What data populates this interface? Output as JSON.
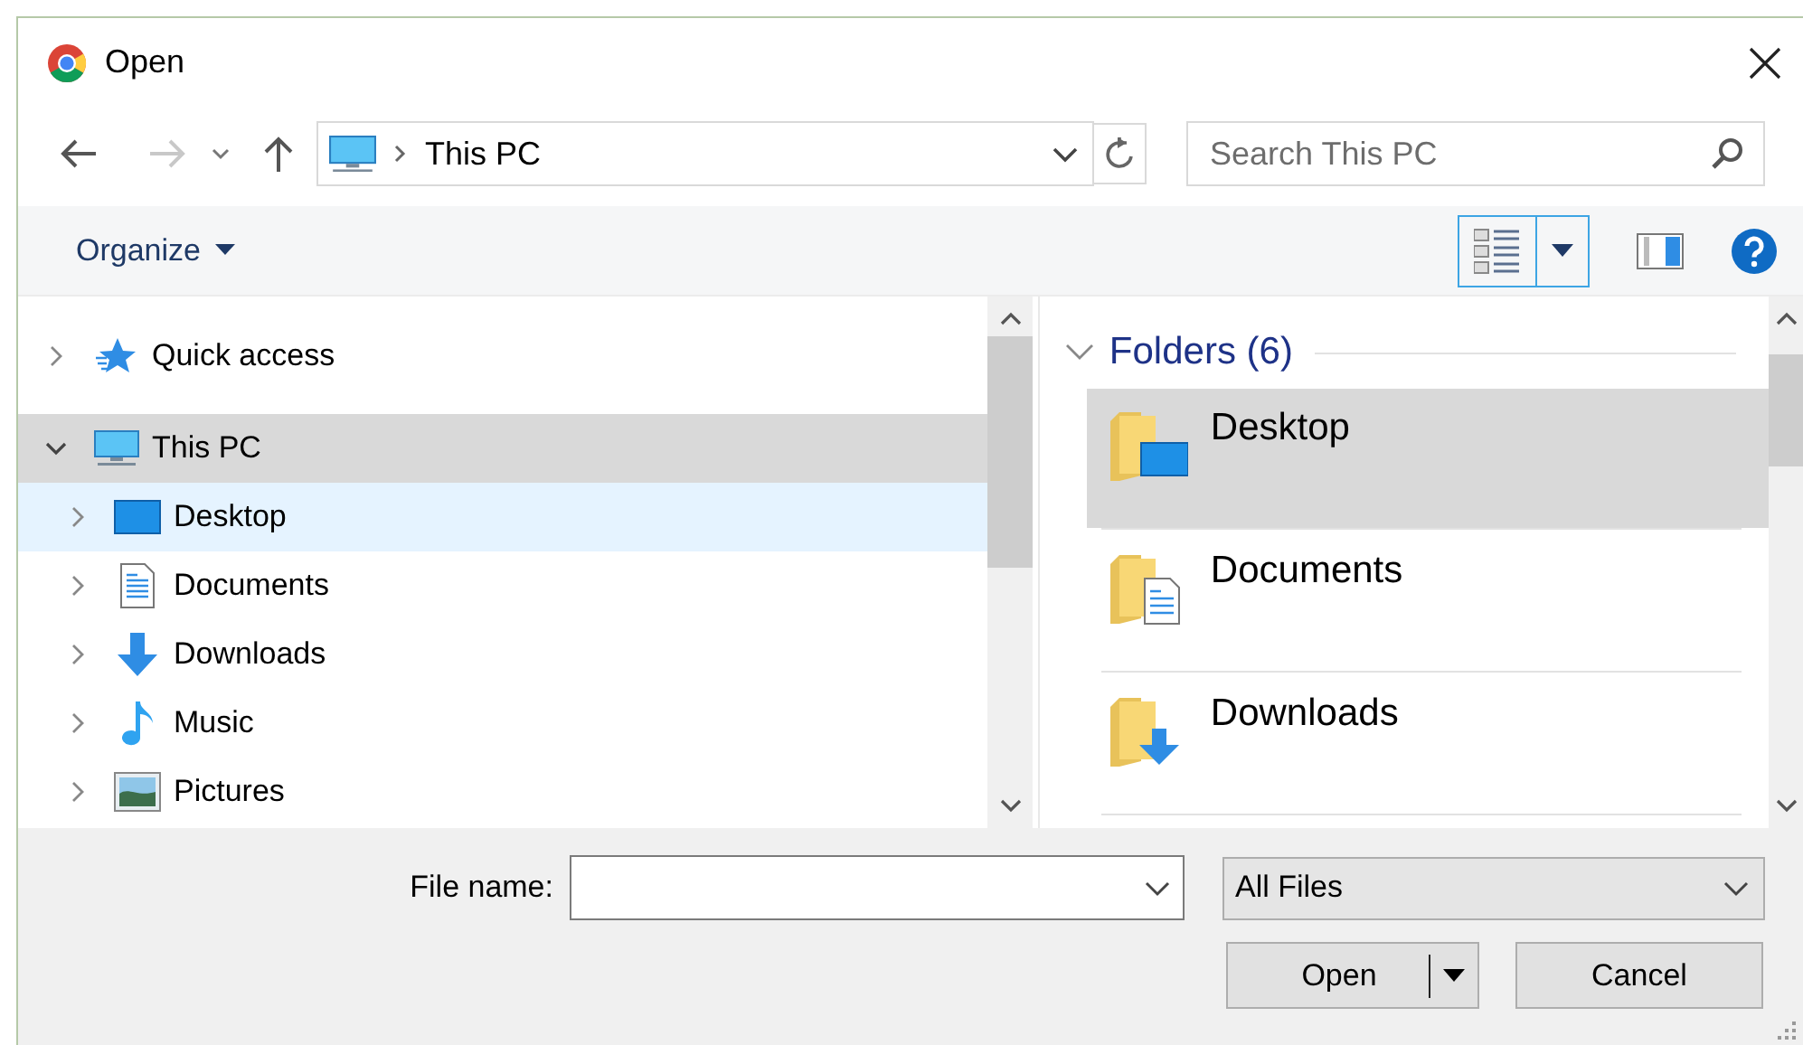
{
  "window": {
    "title": "Open"
  },
  "navigation": {
    "address": "This PC",
    "search": {
      "placeholder": "Search This PC"
    }
  },
  "toolbar": {
    "organize": "Organize"
  },
  "tree": [
    {
      "label": "Quick access",
      "expanded": false,
      "selected": false,
      "hover": false
    },
    {
      "label": "This PC",
      "expanded": true,
      "selected": true,
      "hover": false,
      "children": [
        {
          "label": "Desktop",
          "expanded": false,
          "selected": false,
          "hover": true
        },
        {
          "label": "Documents",
          "expanded": false,
          "selected": false,
          "hover": false
        },
        {
          "label": "Downloads",
          "expanded": false,
          "selected": false,
          "hover": false
        },
        {
          "label": "Music",
          "expanded": false,
          "selected": false,
          "hover": false
        },
        {
          "label": "Pictures",
          "expanded": false,
          "selected": false,
          "hover": false
        }
      ]
    }
  ],
  "folders": {
    "header": "Folders (6)",
    "expanded": true,
    "items": [
      {
        "label": "Desktop",
        "selected": true
      },
      {
        "label": "Documents",
        "selected": false
      },
      {
        "label": "Downloads",
        "selected": false
      }
    ]
  },
  "file_name": {
    "label": "File name:"
  },
  "file_type": {
    "value": "All Files"
  },
  "buttons": [
    {
      "label": "Open",
      "kind": "split"
    },
    {
      "label": "Cancel",
      "kind": "plain"
    }
  ]
}
